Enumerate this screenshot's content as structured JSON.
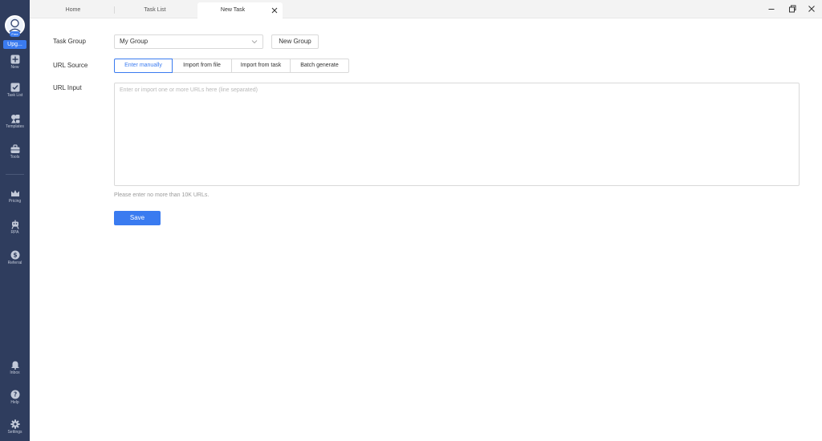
{
  "sidebar": {
    "plan_badge": "Free",
    "upgrade_label": "Upg...",
    "items": [
      {
        "label": "New",
        "icon": "plus-square-icon"
      },
      {
        "label": "Task List",
        "icon": "task-list-icon"
      },
      {
        "label": "Templates",
        "icon": "templates-icon"
      },
      {
        "label": "Tools",
        "icon": "toolbox-icon"
      },
      {
        "label": "Pricing",
        "icon": "crown-icon"
      },
      {
        "label": "RPA",
        "icon": "robot-icon"
      },
      {
        "label": "Referral",
        "icon": "dollar-icon"
      },
      {
        "label": "Inbox",
        "icon": "bell-icon"
      },
      {
        "label": "Help",
        "icon": "help-icon"
      },
      {
        "label": "Settings",
        "icon": "gear-icon"
      }
    ]
  },
  "tabs": [
    {
      "label": "Home"
    },
    {
      "label": "Task List"
    },
    {
      "label": "New Task",
      "active": true
    }
  ],
  "form": {
    "task_group_label": "Task Group",
    "task_group_value": "My Group",
    "new_group_label": "New Group",
    "url_source_label": "URL Source",
    "url_source_options": [
      "Enter manually",
      "Import from file",
      "Import from task",
      "Batch generate"
    ],
    "url_source_selected": "Enter manually",
    "url_input_label": "URL Input",
    "url_input_value": "",
    "url_input_placeholder": "Enter or import one or more URLs here (line separated)",
    "hint": "Please enter no more than 10K URLs.",
    "save_label": "Save"
  },
  "colors": {
    "sidebar_bg": "#2f3d5e",
    "accent": "#3a7bf0"
  }
}
